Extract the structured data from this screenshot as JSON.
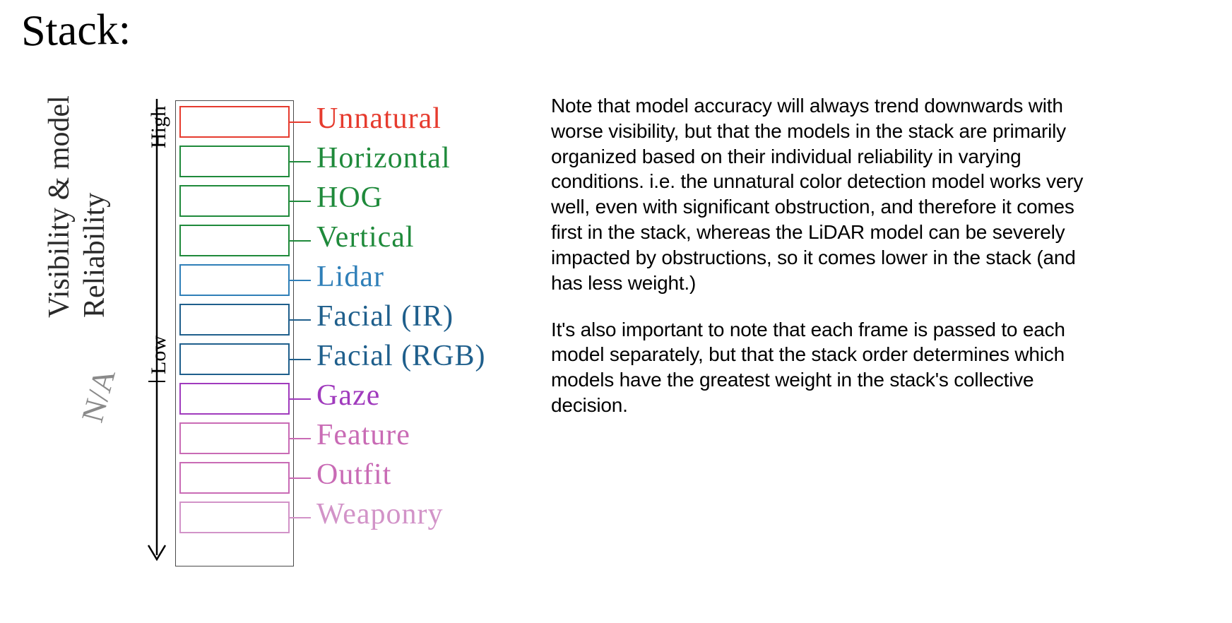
{
  "title": "Stack:",
  "side_labels": {
    "visibility": "Visibility & model",
    "reliability": "Reliability",
    "na": "N/A"
  },
  "scale": {
    "high": "High",
    "low": "Low"
  },
  "stack": [
    {
      "label": "Unnatural",
      "color": "#e63b2e"
    },
    {
      "label": "Horizontal",
      "color": "#1f8a3b"
    },
    {
      "label": "HOG",
      "color": "#1f8a3b"
    },
    {
      "label": "Vertical",
      "color": "#1f8a3b"
    },
    {
      "label": "Lidar",
      "color": "#2f7fb8"
    },
    {
      "label": "Facial (IR)",
      "color": "#1f5f8c"
    },
    {
      "label": "Facial (RGB)",
      "color": "#1f5f8c"
    },
    {
      "label": "Gaze",
      "color": "#a03bbd"
    },
    {
      "label": "Feature",
      "color": "#c96bb5"
    },
    {
      "label": "Outfit",
      "color": "#c96bb5"
    },
    {
      "label": "Weaponry",
      "color": "#d293c8"
    }
  ],
  "paragraphs": {
    "p1": "Note that model accuracy will always trend downwards with worse visibility, but that the models in the stack are primarily organized based on their individual reliability in varying conditions. i.e. the unnatural color detection model works very well, even with significant obstruction, and therefore it comes first in the stack, whereas the LiDAR model can be severely impacted by obstructions, so it comes lower in the stack (and has less weight.)",
    "p2": "It's also important to note that each frame is passed to each model separately, but that the stack order determines which models have the greatest weight in the stack's collective decision."
  }
}
